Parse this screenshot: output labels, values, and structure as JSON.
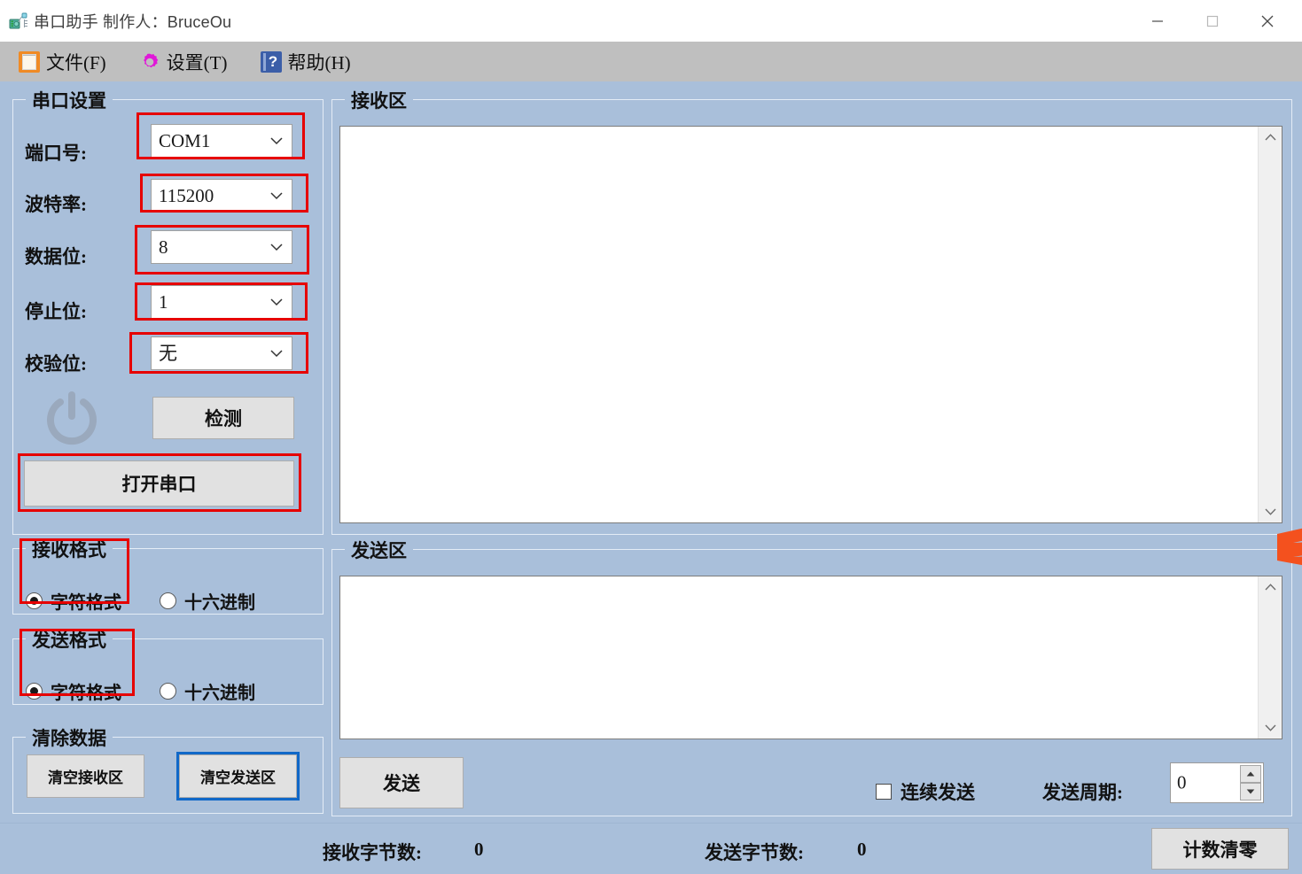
{
  "window": {
    "title": "串口助手 制作人：BruceOu",
    "icon": "serial-port-icon",
    "controls": {
      "minimize": "minimize-icon",
      "maximize": "maximize-icon",
      "close": "close-icon"
    }
  },
  "menubar": {
    "items": [
      {
        "label": "文件(F)",
        "icon": "file-document-icon"
      },
      {
        "label": "设置(T)",
        "icon": "gear-icon"
      },
      {
        "label": "帮助(H)",
        "icon": "help-book-icon"
      }
    ]
  },
  "serial_settings": {
    "title": "串口设置",
    "fields": [
      {
        "label": "端口号:",
        "value": "COM1"
      },
      {
        "label": "波特率:",
        "value": "115200"
      },
      {
        "label": "数据位:",
        "value": "8"
      },
      {
        "label": "停止位:",
        "value": "1"
      },
      {
        "label": "校验位:",
        "value": "无"
      }
    ],
    "detect_button": "检测",
    "open_button": "打开串口",
    "power_icon": "power-icon"
  },
  "receive_format": {
    "title": "接收格式",
    "options": [
      {
        "label": "字符格式",
        "selected": true
      },
      {
        "label": "十六进制",
        "selected": false
      }
    ]
  },
  "send_format": {
    "title": "发送格式",
    "options": [
      {
        "label": "字符格式",
        "selected": true
      },
      {
        "label": "十六进制",
        "selected": false
      }
    ]
  },
  "clear_data": {
    "title": "清除数据",
    "clear_receive_button": "清空接收区",
    "clear_send_button": "清空发送区"
  },
  "receive_area": {
    "title": "接收区",
    "content": "",
    "scrollbar": {
      "up": "chevron-up-icon",
      "down": "chevron-down-icon"
    }
  },
  "send_area": {
    "title": "发送区",
    "content": "",
    "scrollbar": {
      "up": "chevron-up-icon",
      "down": "chevron-down-icon"
    },
    "send_button": "发送",
    "repeat_checkbox": {
      "label": "连续发送",
      "checked": false
    },
    "period_label": "发送周期:",
    "period_value": "0"
  },
  "statusbar": {
    "receive_bytes_label": "接收字节数:",
    "receive_bytes_value": "0",
    "send_bytes_label": "发送字节数:",
    "send_bytes_value": "0",
    "reset_count_button": "计数清零"
  },
  "colors": {
    "window_background": "#a9bfda",
    "menubar_background": "#bfbfbf",
    "annotation_red": "#e60000",
    "focus_blue": "#1068c8",
    "file_icon_orange": "#f08a24",
    "gear_icon_magenta": "#e018d8",
    "help_icon_blue": "#3b5ea8",
    "edge_logo_orange": "#f4511e"
  }
}
